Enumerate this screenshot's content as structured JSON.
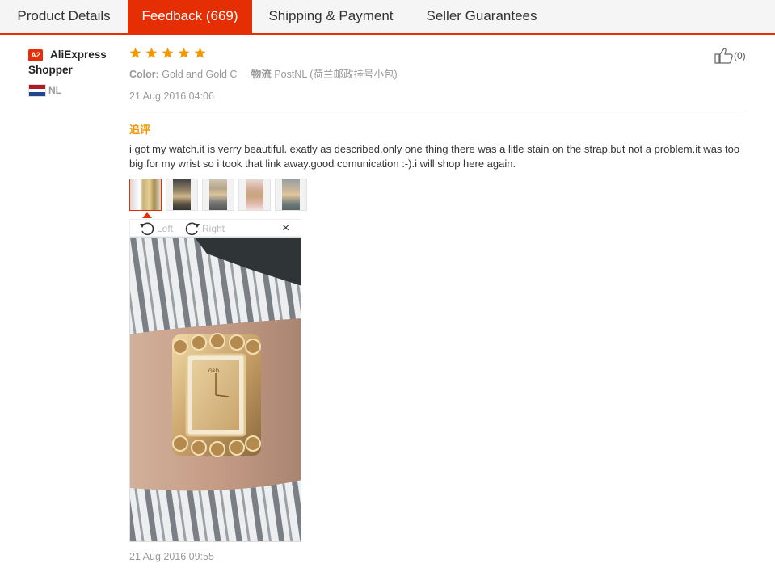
{
  "tabs": [
    {
      "label": "Product Details",
      "active": false
    },
    {
      "label": "Feedback (669)",
      "active": true
    },
    {
      "label": "Shipping & Payment",
      "active": false
    },
    {
      "label": "Seller Guarantees",
      "active": false
    }
  ],
  "buyer": {
    "badge": "A2",
    "name": "AliExpress Shopper",
    "country": "NL",
    "flag_colors": [
      "#ae1c28",
      "#ffffff",
      "#21468b"
    ]
  },
  "review": {
    "rating": 5,
    "star_color": "#f39800",
    "color_label": "Color:",
    "color_value": "Gold and Gold C",
    "logistics_label": "物流",
    "logistics_value": "PostNL (荷兰邮政挂号小包)",
    "date": "21 Aug 2016 04:06",
    "likes": "(0)",
    "followup_label": "追评",
    "text": "i got my watch.it is verry beautiful. exatly as described.only one thing there was a litle stain on the strap.but not a problem.it was too big for my wrist so i took that link away.good comunication :-).i will shop here again.",
    "thumbnail_count": 5,
    "rotate_left": "Left",
    "rotate_right": "Right",
    "close": "×",
    "followup_date": "21 Aug 2016 09:55"
  },
  "colors": {
    "accent": "#e62e04",
    "followup": "#f39800"
  }
}
